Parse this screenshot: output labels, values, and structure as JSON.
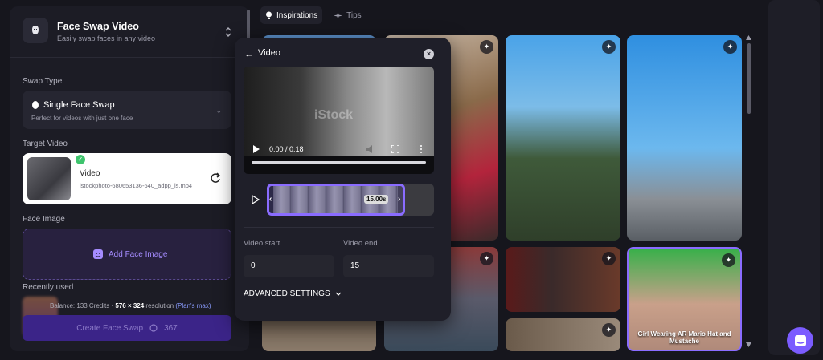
{
  "app": {
    "title": "Face Swap Video",
    "subtitle": "Easily swap faces in any video"
  },
  "swap_type": {
    "section_label": "Swap Type",
    "title": "Single Face Swap",
    "subtitle": "Perfect for videos with just one face"
  },
  "target_video": {
    "section_label": "Target Video",
    "title": "Video",
    "filename": "istockphoto-680653136-640_adpp_is.mp4"
  },
  "face_image": {
    "section_label": "Face Image",
    "add_label": "Add Face Image"
  },
  "recently_used": {
    "label": "Recently used"
  },
  "footer": {
    "balance": "Balance: 133 Credits",
    "resolution_value": "576 × 324",
    "resolution_text": "resolution",
    "plan_link": "(Plan's max)",
    "create_label": "Create Face Swap",
    "credit_cost": "367"
  },
  "tabs": [
    {
      "label": "Inspirations",
      "active": true
    },
    {
      "label": "Tips",
      "active": false
    }
  ],
  "gallery": {
    "caption": "Girl Wearing AR Mario Hat and Mustache"
  },
  "popup": {
    "title": "Video",
    "watermark": "iStock",
    "time": "0:00 / 0:18",
    "trim_duration": "15.00s",
    "video_start_label": "Video start",
    "video_start_value": "0",
    "video_end_label": "Video end",
    "video_end_value": "15",
    "advanced_label": "ADVANCED SETTINGS"
  },
  "colors": {
    "accent": "#7b5cff",
    "success": "#3ec46d",
    "link": "#8a9cff"
  }
}
